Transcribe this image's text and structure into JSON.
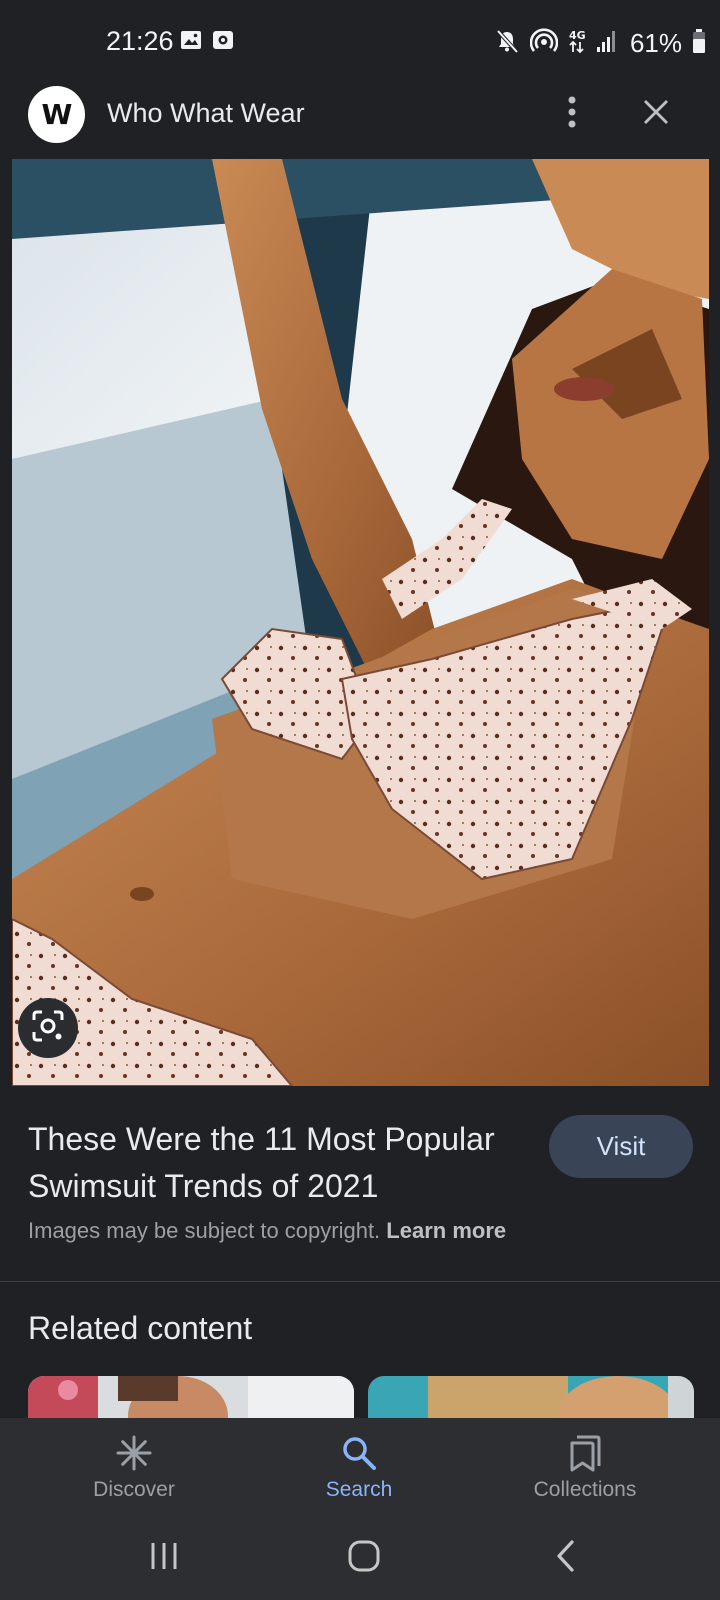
{
  "status_bar": {
    "time": "21:26",
    "battery": "61%",
    "icons": [
      "image-notification-icon",
      "camera-notification-icon",
      "mute-icon",
      "hotspot-icon",
      "4g-icon",
      "signal-icon",
      "battery-icon"
    ]
  },
  "header": {
    "site_logo": "W",
    "site_name": "Who What Wear",
    "icons": [
      "more-vert-icon",
      "close-icon"
    ]
  },
  "image": {
    "lens_icon": "google-lens-icon"
  },
  "result": {
    "title": "These Were the 11 Most Popular Swimsuit Trends of 2021",
    "visit_label": "Visit",
    "copyright_text": "Images may be subject to copyright.",
    "learn_more": "Learn more"
  },
  "related": {
    "heading": "Related content"
  },
  "bottom_nav": {
    "items": [
      {
        "label": "Discover",
        "icon": "asterisk-icon",
        "active": false
      },
      {
        "label": "Search",
        "icon": "search-icon",
        "active": true
      },
      {
        "label": "Collections",
        "icon": "bookmarks-icon",
        "active": false
      }
    ]
  },
  "system_nav": {
    "icons": [
      "recent-apps-icon",
      "home-icon",
      "back-icon"
    ]
  },
  "colors": {
    "background": "#202124",
    "accent": "#8ab4f8",
    "visit_button": "#394457"
  }
}
